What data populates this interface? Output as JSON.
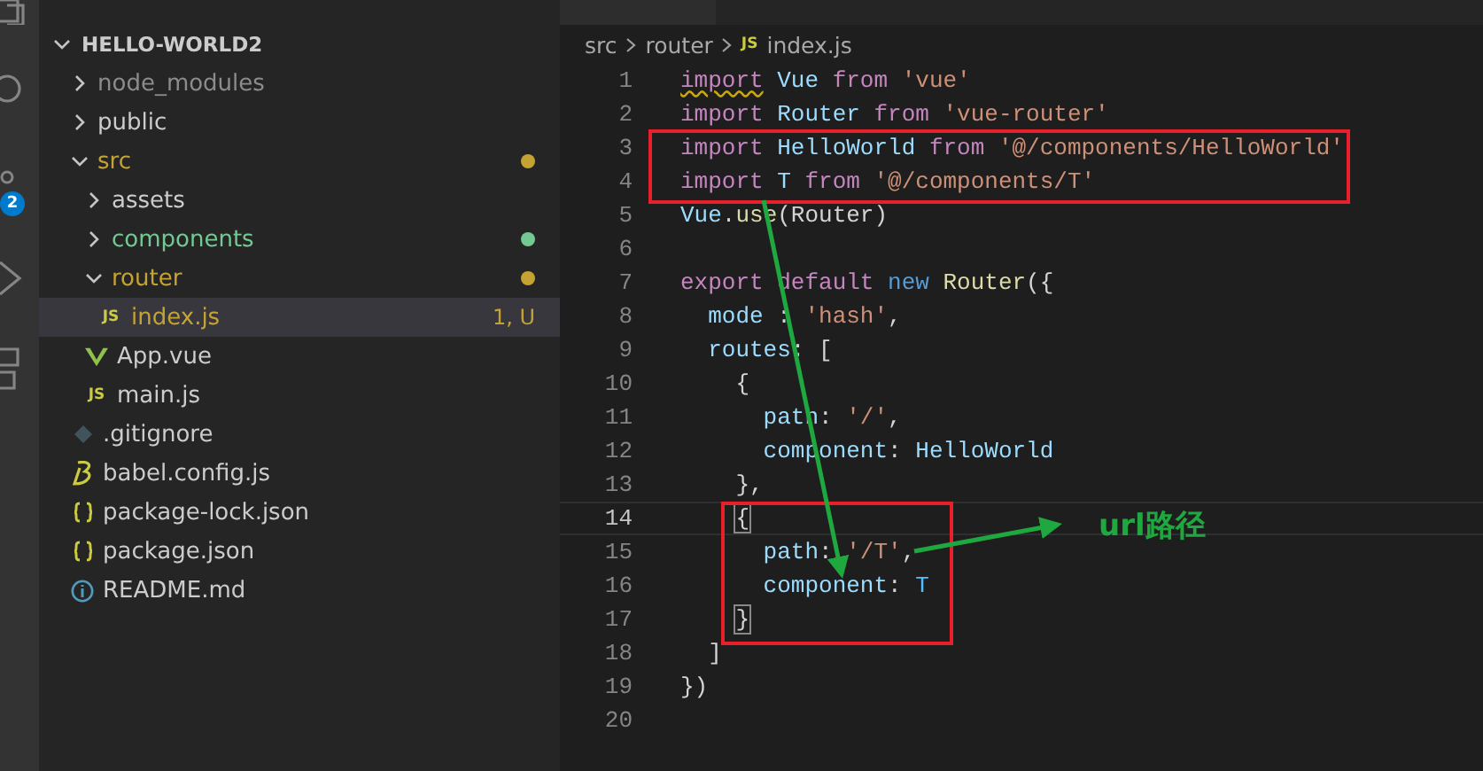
{
  "activity_bar": {
    "badge": "2"
  },
  "explorer": {
    "title": "HELLO-WORLD2",
    "expanded": true,
    "items": [
      {
        "name": "node_modules",
        "kind": "folder",
        "expanded": false,
        "selected": false,
        "dot": false,
        "color": "#8c8c8c"
      },
      {
        "name": "public",
        "kind": "folder",
        "expanded": false,
        "selected": false,
        "dot": false,
        "color": "#cccccc"
      },
      {
        "name": "src",
        "kind": "folder",
        "expanded": true,
        "selected": false,
        "dot": true,
        "color": "#c5a332",
        "children": [
          {
            "name": "assets",
            "kind": "folder",
            "expanded": false,
            "selected": false,
            "dot": false,
            "color": "#cccccc"
          },
          {
            "name": "components",
            "kind": "folder",
            "expanded": false,
            "selected": false,
            "dot": true,
            "color": "#73c991"
          },
          {
            "name": "router",
            "kind": "folder",
            "expanded": true,
            "selected": false,
            "dot": true,
            "color": "#c5a332",
            "children": [
              {
                "name": "index.js",
                "kind": "js",
                "icon_label": "JS",
                "selected": true,
                "dot": false,
                "color": "#c5a332",
                "decoration": "1, U"
              }
            ]
          },
          {
            "name": "App.vue",
            "kind": "vue",
            "selected": false,
            "dot": false,
            "color": "#cccccc"
          },
          {
            "name": "main.js",
            "kind": "js",
            "icon_label": "JS",
            "selected": false,
            "dot": false,
            "color": "#cccccc"
          }
        ]
      },
      {
        "name": ".gitignore",
        "kind": "git",
        "selected": false,
        "dot": false,
        "color": "#cccccc"
      },
      {
        "name": "babel.config.js",
        "kind": "babel",
        "selected": false,
        "dot": false,
        "color": "#cccccc"
      },
      {
        "name": "package-lock.json",
        "kind": "json",
        "selected": false,
        "dot": false,
        "color": "#cccccc"
      },
      {
        "name": "package.json",
        "kind": "json",
        "selected": false,
        "dot": false,
        "color": "#cccccc"
      },
      {
        "name": "README.md",
        "kind": "info",
        "selected": false,
        "dot": false,
        "color": "#cccccc"
      }
    ]
  },
  "breadcrumb": [
    {
      "text": "src"
    },
    {
      "text": "router"
    },
    {
      "text": "index.js",
      "icon_label": "JS"
    }
  ],
  "editor": {
    "lines": [
      {
        "number": "1",
        "current": false,
        "tokens": [
          {
            "text": "import",
            "kind": "warned-keyword"
          },
          {
            "text": " Vue",
            "kind": "variable"
          },
          {
            "text": " from ",
            "kind": "keyword"
          },
          {
            "text": "'vue'",
            "kind": "string"
          }
        ]
      },
      {
        "number": "2",
        "current": false,
        "tokens": [
          {
            "text": "import",
            "kind": "keyword"
          },
          {
            "text": " Router",
            "kind": "variable"
          },
          {
            "text": " from ",
            "kind": "keyword"
          },
          {
            "text": "'vue-router'",
            "kind": "string"
          }
        ]
      },
      {
        "number": "3",
        "current": false,
        "tokens": [
          {
            "text": "import",
            "kind": "keyword"
          },
          {
            "text": " HelloWorld",
            "kind": "variable"
          },
          {
            "text": " from ",
            "kind": "keyword"
          },
          {
            "text": "'@/components/HelloWorld'",
            "kind": "string"
          }
        ]
      },
      {
        "number": "4",
        "current": false,
        "tokens": [
          {
            "text": "import",
            "kind": "keyword"
          },
          {
            "text": " T",
            "kind": "variable"
          },
          {
            "text": " from ",
            "kind": "keyword"
          },
          {
            "text": "'@/components/T'",
            "kind": "string"
          }
        ]
      },
      {
        "number": "5",
        "current": false,
        "tokens": [
          {
            "text": "Vue",
            "kind": "variable"
          },
          {
            "text": ".",
            "kind": "plain"
          },
          {
            "text": "use",
            "kind": "function"
          },
          {
            "text": "(Router)",
            "kind": "plain"
          }
        ]
      },
      {
        "number": "6",
        "current": false
      },
      {
        "number": "7",
        "current": false,
        "tokens": [
          {
            "text": "export default",
            "kind": "keyword"
          },
          {
            "text": " new",
            "kind": "storage"
          },
          {
            "text": " Router",
            "kind": "function"
          },
          {
            "text": "({",
            "kind": "plain"
          }
        ]
      },
      {
        "number": "8",
        "current": false,
        "tokens": [
          {
            "text": "  mode",
            "kind": "variable"
          },
          {
            "text": " : ",
            "kind": "plain"
          },
          {
            "text": "'hash'",
            "kind": "string"
          },
          {
            "text": ",",
            "kind": "plain"
          }
        ]
      },
      {
        "number": "9",
        "current": false,
        "tokens": [
          {
            "text": "  routes",
            "kind": "variable"
          },
          {
            "text": ": [",
            "kind": "plain"
          }
        ]
      },
      {
        "number": "10",
        "current": false,
        "tokens": [
          {
            "text": "    {",
            "kind": "plain"
          }
        ]
      },
      {
        "number": "11",
        "current": false,
        "tokens": [
          {
            "text": "      path",
            "kind": "variable"
          },
          {
            "text": ": ",
            "kind": "plain"
          },
          {
            "text": "'/'",
            "kind": "string"
          },
          {
            "text": ",",
            "kind": "plain"
          }
        ]
      },
      {
        "number": "12",
        "current": false,
        "tokens": [
          {
            "text": "      component",
            "kind": "variable"
          },
          {
            "text": ": ",
            "kind": "plain"
          },
          {
            "text": "HelloWorld",
            "kind": "variable"
          }
        ]
      },
      {
        "number": "13",
        "current": false,
        "tokens": [
          {
            "text": "    },",
            "kind": "plain"
          }
        ]
      },
      {
        "number": "14",
        "current": true,
        "tokens": [
          {
            "text": "    {",
            "kind": "bracket-match"
          }
        ]
      },
      {
        "number": "15",
        "current": false,
        "tokens": [
          {
            "text": "      path",
            "kind": "variable"
          },
          {
            "text": ": ",
            "kind": "plain"
          },
          {
            "text": "'/T'",
            "kind": "string"
          },
          {
            "text": ",",
            "kind": "plain"
          }
        ]
      },
      {
        "number": "16",
        "current": false,
        "tokens": [
          {
            "text": "      component",
            "kind": "variable"
          },
          {
            "text": ": ",
            "kind": "plain"
          },
          {
            "text": "T",
            "kind": "constant"
          }
        ]
      },
      {
        "number": "17",
        "current": false,
        "tokens": [
          {
            "text": "    }",
            "kind": "bracket-match"
          }
        ]
      },
      {
        "number": "18",
        "current": false,
        "tokens": [
          {
            "text": "  ]",
            "kind": "plain"
          }
        ]
      },
      {
        "number": "19",
        "current": false,
        "tokens": [
          {
            "text": "})",
            "kind": "plain"
          }
        ]
      },
      {
        "number": "20",
        "current": false
      }
    ]
  },
  "annotations": {
    "label": "url路径"
  }
}
